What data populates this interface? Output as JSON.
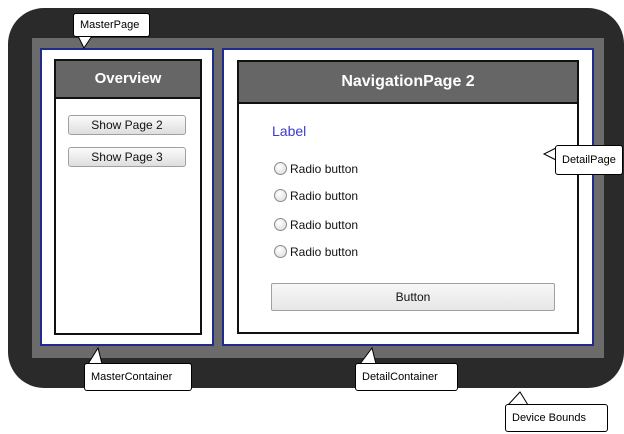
{
  "callouts": {
    "master_page": "MasterPage",
    "detail_page": "DetailPage",
    "master_container": "MasterContainer",
    "detail_container": "DetailContainer",
    "device_bounds": "Device Bounds"
  },
  "master": {
    "header_title": "Overview",
    "buttons": [
      "Show Page 2",
      "Show Page 3"
    ]
  },
  "detail": {
    "header_title": "NavigationPage 2",
    "label": "Label",
    "radio_buttons": [
      "Radio button",
      "Radio button",
      "Radio button",
      "Radio button"
    ],
    "button_label": "Button"
  },
  "colors": {
    "device": "#2a2a2a",
    "screen": "#6b6b6b",
    "container_border": "#1f2a8a",
    "header_bg": "#666666",
    "label_text": "#3a3acc"
  }
}
